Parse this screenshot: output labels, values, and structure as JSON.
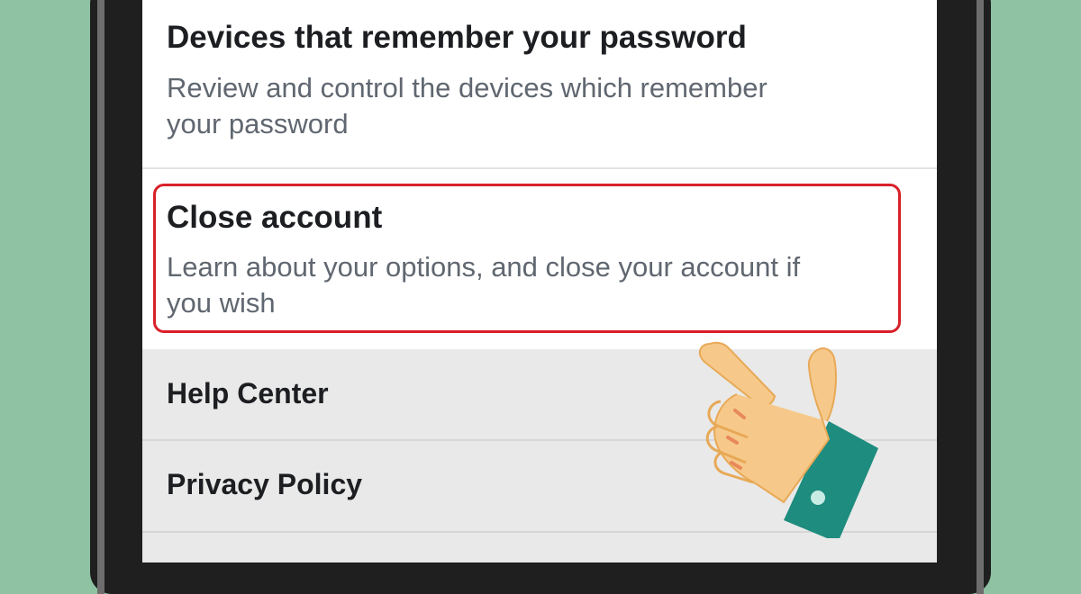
{
  "settings_list": {
    "devices_item": {
      "title": "Devices that remember your password",
      "description_line1": "Review and control the devices which remember",
      "description_line2": "your password"
    },
    "close_account_item": {
      "title": "Close account",
      "description_line1": "Learn about your options, and close your account if",
      "description_line2": "you wish"
    },
    "help_center": {
      "label": "Help Center"
    },
    "privacy_policy": {
      "label": "Privacy Policy"
    }
  },
  "colors": {
    "background": "#8fc2a2",
    "highlight": "#d9202a",
    "title_text": "#1c1e21",
    "description_text": "#606770",
    "gray_section": "#e9e9e9"
  },
  "icons": {
    "pointer": "pointing-hand-icon"
  }
}
